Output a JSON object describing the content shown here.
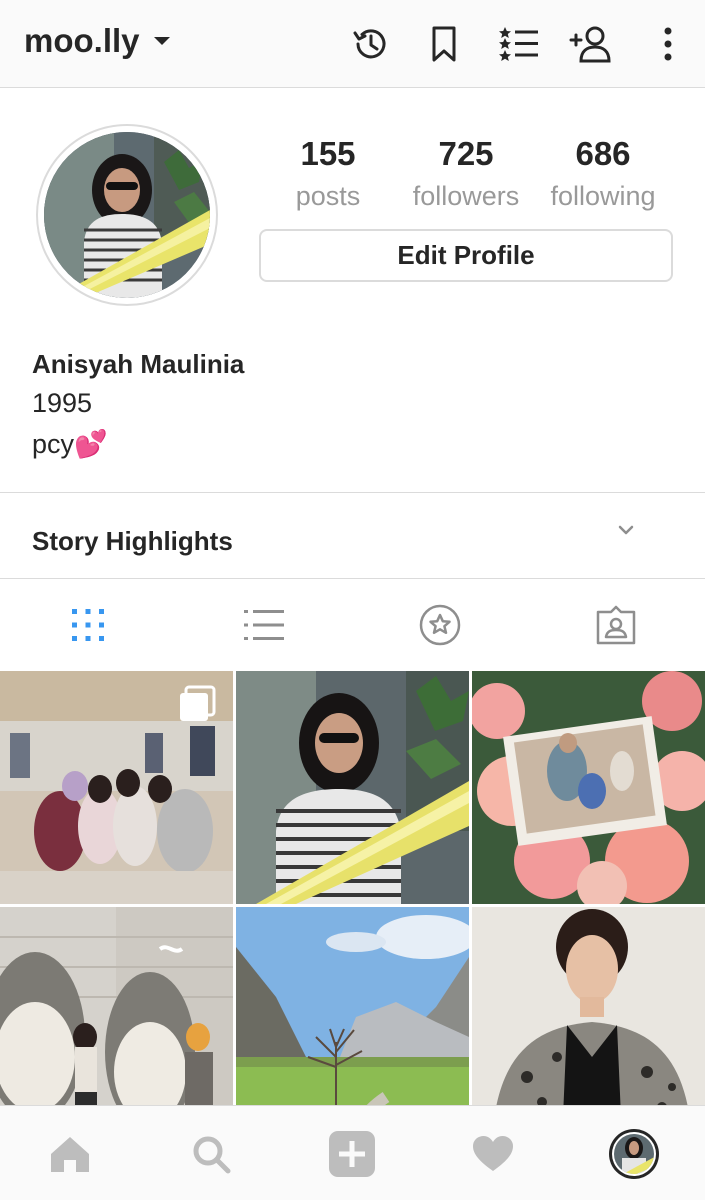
{
  "header": {
    "username": "moo.lly",
    "icons": [
      "archive-icon",
      "bookmark-icon",
      "close-friends-icon",
      "discover-people-icon",
      "more-icon"
    ]
  },
  "profile": {
    "posts_count": "155",
    "posts_label": "posts",
    "followers_count": "725",
    "followers_label": "followers",
    "following_count": "686",
    "following_label": "following",
    "edit_button": "Edit Profile",
    "name": "Anisyah Maulinia",
    "bio_lines": [
      "1995",
      "pcy💕"
    ]
  },
  "highlights": {
    "title": "Story Highlights"
  },
  "tabs": [
    {
      "icon": "grid-icon",
      "active": true
    },
    {
      "icon": "list-icon",
      "active": false
    },
    {
      "icon": "star-icon",
      "active": false
    },
    {
      "icon": "tagged-icon",
      "active": false
    }
  ],
  "posts": [
    {
      "subject": "group-photo-mall",
      "multi": true
    },
    {
      "subject": "portrait-sunglasses"
    },
    {
      "subject": "photo-with-roses"
    },
    {
      "subject": "totoro-collage"
    },
    {
      "subject": "alpine-valley"
    },
    {
      "subject": "man-patterned-jacket"
    }
  ],
  "bottom_nav": [
    "home-icon",
    "search-icon",
    "new-post-icon",
    "activity-icon",
    "profile-avatar"
  ],
  "colors": {
    "accent": "#3897f0",
    "text": "#262626",
    "muted": "#999999",
    "border": "#dbdbdb",
    "nav_icon": "#bdbdbd"
  }
}
